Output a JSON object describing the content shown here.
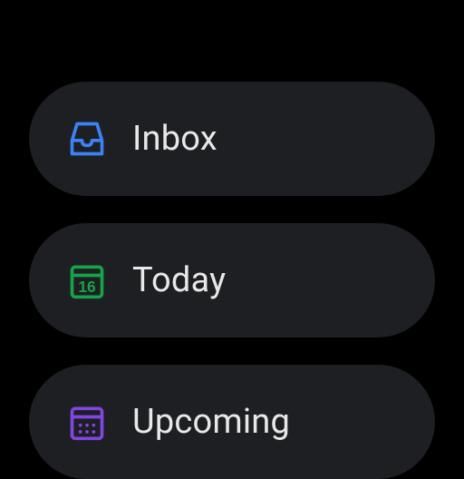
{
  "menu": {
    "items": [
      {
        "label": "Inbox",
        "icon": "inbox-icon",
        "color": "#3b82f6"
      },
      {
        "label": "Today",
        "icon": "calendar-today-icon",
        "color": "#16a34a",
        "day": "16"
      },
      {
        "label": "Upcoming",
        "icon": "calendar-upcoming-icon",
        "color": "#8046e2"
      }
    ]
  }
}
